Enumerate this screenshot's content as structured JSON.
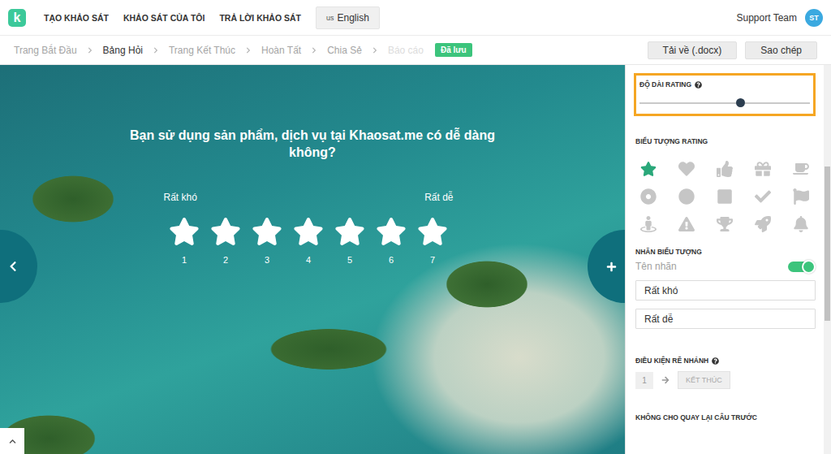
{
  "app": {
    "logo": "k",
    "nav": [
      "TẠO KHẢO SÁT",
      "KHẢO SÁT CỦA TÔI",
      "TRẢ LỜI KHẢO SÁT"
    ],
    "language": {
      "flag": "us",
      "label": "English"
    },
    "user": {
      "name": "Support Team",
      "initials": "ST"
    }
  },
  "steps": [
    {
      "label": "Trang Bắt Đầu",
      "selected": false,
      "disabled": false
    },
    {
      "label": "Bảng Hỏi",
      "selected": true,
      "disabled": false
    },
    {
      "label": "Trang Kết Thúc",
      "selected": false,
      "disabled": false
    },
    {
      "label": "Hoàn Tất",
      "selected": false,
      "disabled": false
    },
    {
      "label": "Chia Sẻ",
      "selected": false,
      "disabled": false
    },
    {
      "label": "Báo cáo",
      "selected": false,
      "disabled": true
    }
  ],
  "save_badge": "Đã lưu",
  "actions": [
    "Tải về (.docx)",
    "Sao chép"
  ],
  "question": {
    "text": "Bạn sử dụng sản phẩm, dịch vụ tại Khaosat.me có dễ dàng không?",
    "low_label": "Rất khó",
    "high_label": "Rất dễ",
    "stars": 0,
    "scale": [
      "1",
      "2",
      "3",
      "4",
      "5",
      "6",
      "7"
    ]
  },
  "settings": {
    "length": {
      "label": "ĐỘ DÀI RATING",
      "level": 0.59,
      "highlighted": true
    },
    "icons": {
      "label": "BIỂU TƯỢNG RATING",
      "items": [
        {
          "selected": true
        },
        {
          "selected": false
        },
        {
          "selected": false
        },
        {
          "selected": false
        },
        {
          "selected": false
        },
        {
          "selected": false
        },
        {
          "selected": false
        },
        {
          "selected": false
        },
        {
          "selected": false
        },
        {
          "selected": false
        },
        {
          "selected": false
        },
        {
          "selected": false
        },
        {
          "selected": false
        },
        {
          "selected": false
        },
        {
          "selected": false
        }
      ]
    },
    "icon_labels": {
      "label": "NHÃN BIỂU TƯỢNG",
      "toggle_label": "Tên nhãn",
      "on": true,
      "fields": [
        "Rất khó",
        "Rất dễ"
      ]
    },
    "branching": {
      "label": "ĐIỀU KIỆN RẼ NHÁNH",
      "from": "1",
      "to": "KẾT THÚC"
    },
    "no_back": {
      "label": "KHÔNG CHO QUAY LẠI CÂU TRƯỚC"
    }
  }
}
